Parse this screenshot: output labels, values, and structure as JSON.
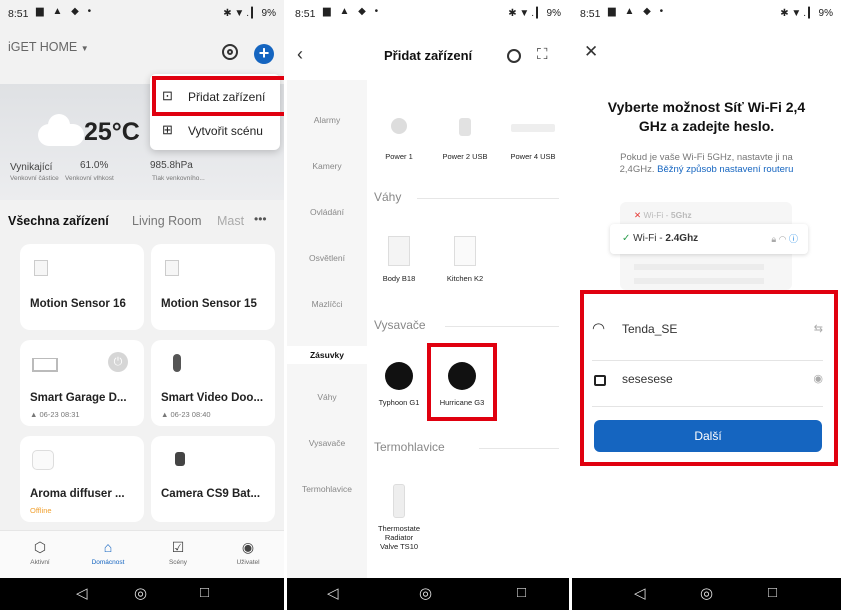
{
  "status": {
    "time": "8:51",
    "right": "✱ ▼ . ▎ 9%"
  },
  "screen1": {
    "home_title": "iGET HOME",
    "weather": {
      "temp": "25°C",
      "v1": "Vynikající",
      "v2": "61.0%",
      "v3": "985.8hPa",
      "l1": "Venkovní částice",
      "l2": "Venkovní vlhkost",
      "l3": "Tlak venkovního..."
    },
    "tabs": [
      "Všechna zařízení",
      "Living Room",
      "Mast"
    ],
    "menu": {
      "add_device": "Přidat zařízení",
      "create_scene": "Vytvořit scénu"
    },
    "devices": [
      {
        "name": "Motion Sensor 16",
        "sub": ""
      },
      {
        "name": "Motion Sensor 15",
        "sub": ""
      },
      {
        "name": "Smart Garage D...",
        "sub": "▲ 06-23 08:31"
      },
      {
        "name": "Smart Video Doo...",
        "sub": "▲ 06-23 08:40"
      },
      {
        "name": "Aroma diffuser ...",
        "sub": "Offline"
      },
      {
        "name": "Camera CS9 Bat...",
        "sub": ""
      }
    ],
    "bottom_tabs": [
      "Aktivní",
      "Domácnost",
      "Scény",
      "Uživatel"
    ],
    "active_color": "#1565c0"
  },
  "screen2": {
    "title": "Přidat zařízení",
    "categories": [
      "Alarmy",
      "Kamery",
      "Ovládání",
      "Osvětlení",
      "Mazlíčci",
      "Zásuvky",
      "Váhy",
      "Vysavače",
      "Termohlavice"
    ],
    "top_products": [
      "Power 1",
      "Power 2 USB",
      "Power 4 USB"
    ],
    "sections": {
      "scales": "Váhy",
      "vacuums": "Vysavače",
      "thermo": "Termohlavice"
    },
    "scales": [
      "Body B18",
      "Kitchen K2"
    ],
    "vacuums": [
      "Typhoon G1",
      "Hurricane G3"
    ],
    "thermo": [
      "Thermostate",
      "Radiator",
      "Valve TS10"
    ]
  },
  "screen3": {
    "heading1": "Vyberte možnost Síť Wi-Fi 2,4",
    "heading2": "GHz a zadejte heslo.",
    "info1": "Pokud je vaše Wi-Fi 5GHz, nastavte ji na",
    "info2": "2,4GHz.",
    "info_link": "Běžný způsob nastavení routeru",
    "bad_wifi": "Wi-Fi - ",
    "bad_wifi_bold": "5Ghz",
    "good_wifi": "Wi-Fi - ",
    "good_wifi_bold": "2.4Ghz",
    "ssid": "Tenda_SE",
    "password": "sesesese",
    "next_button": "Další",
    "accent": "#1565c0"
  }
}
